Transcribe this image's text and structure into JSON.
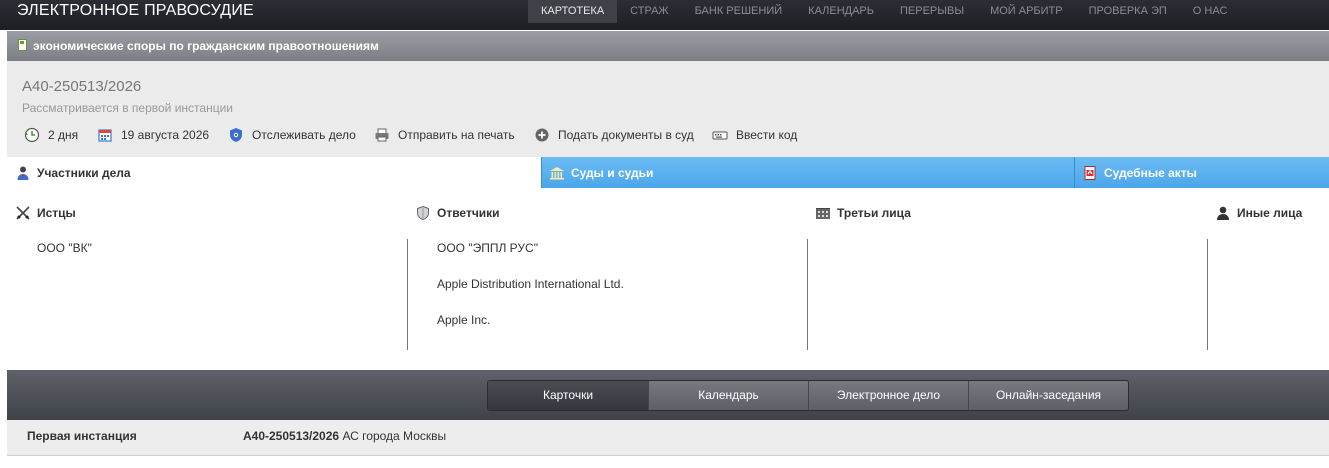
{
  "header": {
    "brand": "ЭЛЕКТРОННОЕ ПРАВОСУДИЕ",
    "nav": [
      "КАРТОТЕКА",
      "СТРАЖ",
      "БАНК РЕШЕНИЙ",
      "КАЛЕНДАРЬ",
      "ПЕРЕРЫВЫ",
      "МОЙ АРБИТР",
      "ПРОВЕРКА ЭП",
      "О НАС"
    ],
    "active_nav": "КАРТОТЕКА"
  },
  "category": {
    "label": "экономические споры по гражданским правоотношениям",
    "icon": "document-icon"
  },
  "case": {
    "number": "А40-250513/2026",
    "status": "Рассматривается в первой инстанции",
    "actions": {
      "duration": "2 дня",
      "date": "19 августа 2026",
      "track": "Отслеживать дело",
      "print": "Отправить на печать",
      "submit": "Подать документы в суд",
      "code": "Ввести код"
    }
  },
  "tabs": {
    "participants": "Участники дела",
    "courts": "Суды и судьи",
    "acts": "Судебные акты"
  },
  "participants": {
    "plaintiffs": {
      "title": "Истцы",
      "items": [
        "ООО \"ВК\""
      ]
    },
    "defendants": {
      "title": "Ответчики",
      "items": [
        "ООО \"ЭППЛ РУС\"",
        "Apple Distribution International Ltd.",
        "Apple Inc."
      ]
    },
    "third_parties": {
      "title": "Третьи лица",
      "items": []
    },
    "others": {
      "title": "Иные лица",
      "items": []
    }
  },
  "bottom_tabs": [
    "Карточки",
    "Календарь",
    "Электронное дело",
    "Онлайн-заседания"
  ],
  "instance": {
    "label": "Первая инстанция",
    "case_number": "А40-250513/2026",
    "court": "АС города Москвы"
  },
  "colors": {
    "tab_blue": "#4aa6ea",
    "topbar": "#1d1f24",
    "accent_green": "#5aa02c"
  }
}
